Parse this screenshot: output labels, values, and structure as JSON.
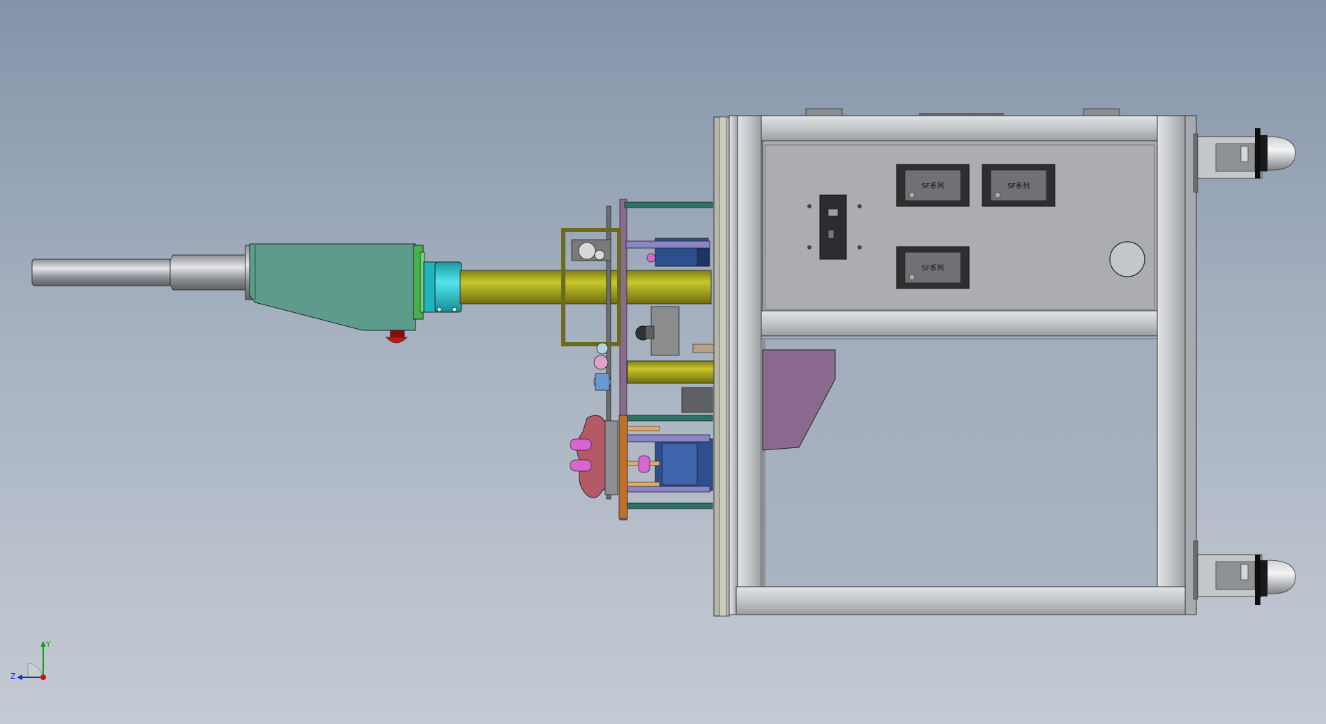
{
  "viewport": {
    "background_top": "#8494a9",
    "background_bottom": "#c4cbd4"
  },
  "model": {
    "label_plate_1": "SF系列",
    "label_plate_2": "SF系列",
    "label_plate_3": "SF系列",
    "colors": {
      "frame": "#b9bcc0",
      "panel": "#a9abae",
      "olive_tube": "#a6a51c",
      "teal_housing": "#5d9c8c",
      "cyan_collar": "#2ec7d0",
      "green_ring": "#43b24a",
      "purple_bracket": "#8a6a8e",
      "blue_motor": "#2e4f8e",
      "red_button": "#c21515"
    }
  },
  "triad": {
    "x_label": "",
    "y_label": "Y",
    "z_label": "Z",
    "x_color": "#d01010",
    "y_color": "#10a010",
    "z_color": "#1030d0"
  }
}
